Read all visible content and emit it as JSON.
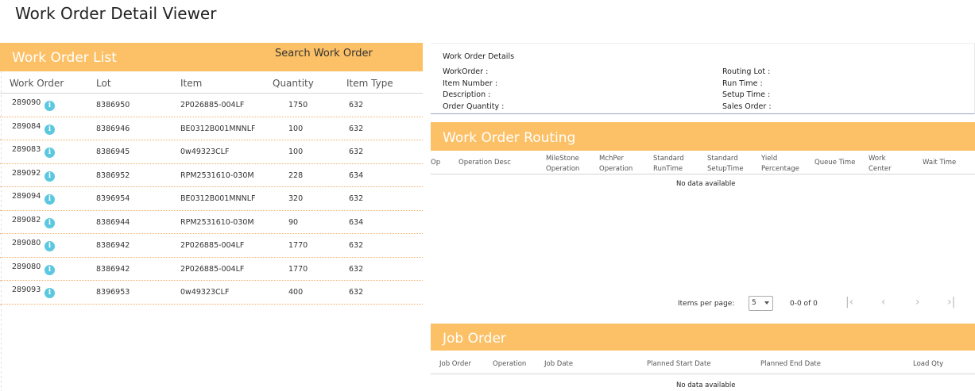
{
  "page": {
    "title": "Work Order Detail Viewer"
  },
  "work_order_list": {
    "title": "Work Order List",
    "search_label": "Search Work Order",
    "columns": [
      "Work Order",
      "Lot",
      "Item",
      "Quantity",
      "Item Type"
    ],
    "rows": [
      {
        "work_order": "289090",
        "lot": "8386950",
        "item": "2P026885-004LF",
        "quantity": "1750",
        "item_type": "632"
      },
      {
        "work_order": "289084",
        "lot": "8386946",
        "item": "BE0312B001MNNLF",
        "quantity": "100",
        "item_type": "632"
      },
      {
        "work_order": "289083",
        "lot": "8386945",
        "item": "0w49323CLF",
        "quantity": "100",
        "item_type": "632"
      },
      {
        "work_order": "289092",
        "lot": "8386952",
        "item": "RPM2531610-030M",
        "quantity": "228",
        "item_type": "634"
      },
      {
        "work_order": "289094",
        "lot": "8396954",
        "item": "BE0312B001MNNLF",
        "quantity": "320",
        "item_type": "632"
      },
      {
        "work_order": "289082",
        "lot": "8386944",
        "item": "RPM2531610-030M",
        "quantity": "90",
        "item_type": "634"
      },
      {
        "work_order": "289080",
        "lot": "8386942",
        "item": "2P026885-004LF",
        "quantity": "1770",
        "item_type": "632"
      },
      {
        "work_order": "289080",
        "lot": "8386942",
        "item": "2P026885-004LF",
        "quantity": "1770",
        "item_type": "632"
      },
      {
        "work_order": "289093",
        "lot": "8396953",
        "item": "0w49323CLF",
        "quantity": "400",
        "item_type": "632"
      }
    ],
    "info_icon": "info-icon",
    "accent_color": "#fcc066",
    "info_icon_color": "#5bc8e0"
  },
  "details": {
    "title": "Work Order Details",
    "left_labels": [
      "WorkOrder :",
      "Item Number :",
      "Description :",
      "Order Quantity :"
    ],
    "right_labels": [
      "Routing Lot :",
      "Run Time :",
      "Setup Time :",
      "Sales Order :"
    ]
  },
  "routing": {
    "title": "Work Order Routing",
    "columns": [
      {
        "line1": "Op",
        "line2": ""
      },
      {
        "line1": "Operation Desc",
        "line2": ""
      },
      {
        "line1": "MileStone",
        "line2": "Operation"
      },
      {
        "line1": "MchPer",
        "line2": "Operation"
      },
      {
        "line1": "Standard",
        "line2": "RunTime"
      },
      {
        "line1": "Standard",
        "line2": "SetupTime"
      },
      {
        "line1": "Yield",
        "line2": "Percentage"
      },
      {
        "line1": "Queue Time",
        "line2": ""
      },
      {
        "line1": "Work",
        "line2": "Center"
      },
      {
        "line1": "Wait Time",
        "line2": ""
      }
    ],
    "empty_text": "No data available"
  },
  "paginator": {
    "items_per_page_label": "Items per page:",
    "items_per_page_value": "5",
    "range_label": "0-0 of 0",
    "buttons": [
      "first-page-icon",
      "previous-page-icon",
      "next-page-icon",
      "last-page-icon"
    ]
  },
  "job_order": {
    "title": "Job Order",
    "columns": [
      "Job Order",
      "Operation",
      "Job Date",
      "Planned Start Date",
      "Planned End Date",
      "Load Qty"
    ],
    "empty_text": "No data available"
  }
}
